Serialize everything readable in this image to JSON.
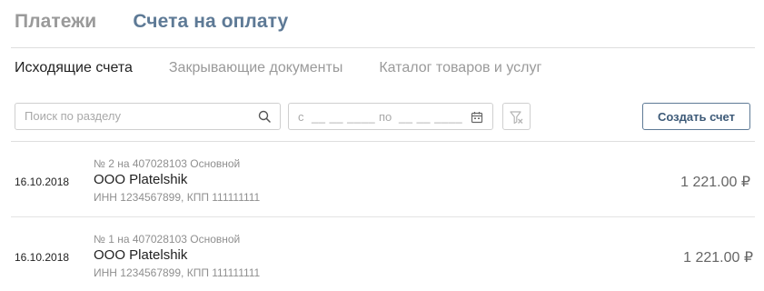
{
  "top_tabs": [
    {
      "label": "Платежи",
      "active": false
    },
    {
      "label": "Счета на оплату",
      "active": true
    }
  ],
  "sub_tabs": [
    {
      "label": "Исходящие счета",
      "active": true
    },
    {
      "label": "Закрывающие документы",
      "active": false
    },
    {
      "label": "Каталог товаров и услуг",
      "active": false
    }
  ],
  "toolbar": {
    "search_placeholder": "Поиск по разделу",
    "search_value": "",
    "date_from_label": "с",
    "date_from_mask": "__ __ ____",
    "date_to_label": "по",
    "date_to_mask": "__ __ ____",
    "create_label": "Создать счет"
  },
  "icons": {
    "search": "search-icon",
    "calendar": "calendar-icon",
    "filter_reset": "filter-clear-icon"
  },
  "colors": {
    "accent": "#5e7a96",
    "muted": "#9a9a9a",
    "border": "#cfcfcf"
  },
  "invoices": [
    {
      "date": "16.10.2018",
      "account": "№ 2 на 407028103 Основной",
      "payer": "ООО Platelshik",
      "inn": "ИНН 1234567899, КПП 111111111",
      "amount": "1 221.00 ₽"
    },
    {
      "date": "16.10.2018",
      "account": "№ 1 на 407028103 Основной",
      "payer": "ООО Platelshik",
      "inn": "ИНН 1234567899, КПП 111111111",
      "amount": "1 221.00 ₽"
    }
  ]
}
